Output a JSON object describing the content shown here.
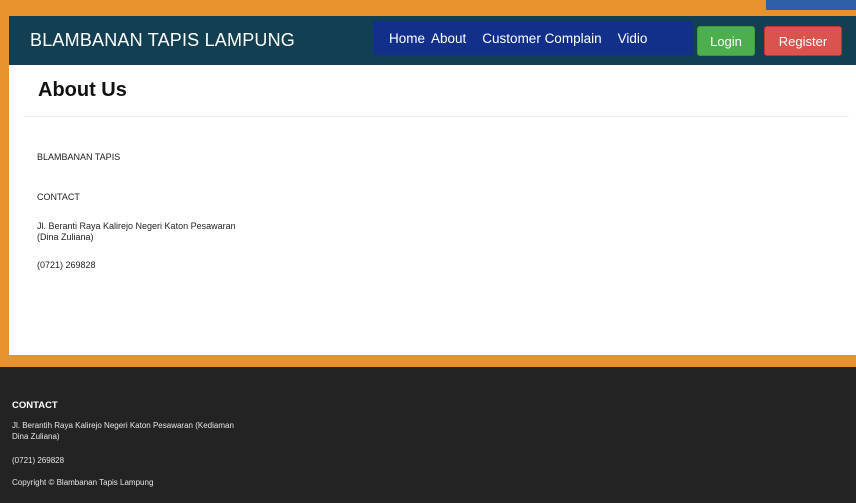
{
  "header": {
    "brand": "BLAMBANAN TAPIS LAMPUNG",
    "nav": [
      "Home",
      "About",
      "Customer Complain",
      "Vidio"
    ],
    "login_label": "Login",
    "register_label": "Register"
  },
  "main": {
    "title": "About Us",
    "company_name": "BLAMBANAN TAPIS",
    "contact_heading": "CONTACT",
    "address_line1": "Jl. Beranti Raya Kalirejo Negeri Katon Pesawaran",
    "address_line2": "(Dina Zuliana)",
    "phone": "(0721) 269828"
  },
  "footer": {
    "heading": "CONTACT",
    "address_line1": "Jl. Berantih Raya Kalirejo Negeri Katon Pesawaran (Kediaman",
    "address_line2": "Dina Zuliana)",
    "phone": "(0721) 269828",
    "copyright": "Copyright © Blambanan Tapis Lampung"
  },
  "colors": {
    "accent_orange": "#e8922e",
    "navbar": "#123f52",
    "nav_menu": "#12308a",
    "login": "#4cae4c",
    "register": "#d9534f",
    "footer": "#232323"
  }
}
